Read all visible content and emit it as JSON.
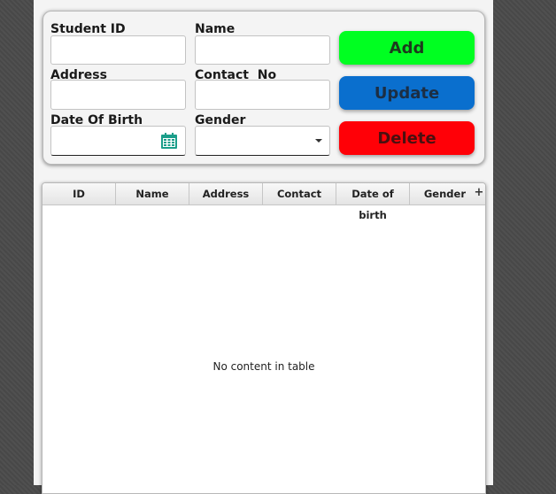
{
  "form": {
    "student_id_label": "Student ID",
    "name_label": "Name",
    "address_label": "Address",
    "contact_label": "Contact  No",
    "dob_label": "Date Of Birth",
    "gender_label": "Gender",
    "student_id_value": "",
    "name_value": "",
    "address_value": "",
    "contact_value": "",
    "dob_value": "",
    "gender_value": ""
  },
  "buttons": {
    "add": "Add",
    "update": "Update",
    "delete": "Delete"
  },
  "colors": {
    "add": "#00ff21",
    "update": "#0a6fce",
    "delete": "#ff0007",
    "calendar_icon": "#1a9e8a"
  },
  "table": {
    "columns": [
      "ID",
      "Name",
      "Address",
      "Contact",
      "Date of birth",
      "Gender"
    ],
    "column_menu": "+",
    "rows": [],
    "placeholder": "No content in table"
  },
  "icons": {
    "datepicker": "calendar-icon",
    "gender_select": "chevron-down-icon",
    "column_menu": "plus-icon"
  }
}
